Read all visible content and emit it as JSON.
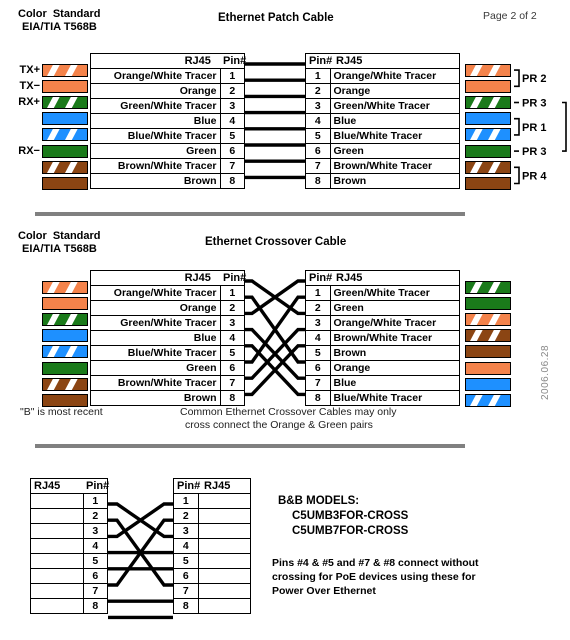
{
  "page": {
    "page_label": "Page 2 of 2",
    "date_stamp": "2006.06.28",
    "footnote": "\"B\" is most recent"
  },
  "standard": {
    "line1": "Color  Standard",
    "line2": "EIA/TIA T568B"
  },
  "colors": {
    "orange": "#F4834B",
    "green": "#1A7A1A",
    "blue": "#1E90FF",
    "brown": "#8B4513",
    "tracer": "#FFFFFF",
    "wire": "#000000",
    "divider": "#808080",
    "datestamp": "#8A8A8A"
  },
  "patch": {
    "title": "Ethernet Patch Cable",
    "left_header": {
      "rj45": "RJ45",
      "pin": "Pin#"
    },
    "right_header": {
      "pin": "Pin#",
      "rj45": "RJ45"
    },
    "signal_labels": [
      {
        "pin": 1,
        "text": "TX+"
      },
      {
        "pin": 2,
        "text": "TX−"
      },
      {
        "pin": 3,
        "text": "RX+"
      },
      {
        "pin": 6,
        "text": "RX−"
      }
    ],
    "left_rows": [
      {
        "pin": "1",
        "name": "Orange/White Tracer",
        "color": "orange",
        "tracer": true
      },
      {
        "pin": "2",
        "name": "Orange",
        "color": "orange",
        "tracer": false
      },
      {
        "pin": "3",
        "name": "Green/White Tracer",
        "color": "green",
        "tracer": true
      },
      {
        "pin": "4",
        "name": "Blue",
        "color": "blue",
        "tracer": false
      },
      {
        "pin": "5",
        "name": "Blue/White Tracer",
        "color": "blue",
        "tracer": true
      },
      {
        "pin": "6",
        "name": "Green",
        "color": "green",
        "tracer": false
      },
      {
        "pin": "7",
        "name": "Brown/White Tracer",
        "color": "brown",
        "tracer": true
      },
      {
        "pin": "8",
        "name": "Brown",
        "color": "brown",
        "tracer": false
      }
    ],
    "right_rows": [
      {
        "pin": "1",
        "name": "Orange/White Tracer",
        "color": "orange",
        "tracer": true
      },
      {
        "pin": "2",
        "name": "Orange",
        "color": "orange",
        "tracer": false
      },
      {
        "pin": "3",
        "name": "Green/White Tracer",
        "color": "green",
        "tracer": true
      },
      {
        "pin": "4",
        "name": "Blue",
        "color": "blue",
        "tracer": false
      },
      {
        "pin": "5",
        "name": "Blue/White Tracer",
        "color": "blue",
        "tracer": true
      },
      {
        "pin": "6",
        "name": "Green",
        "color": "green",
        "tracer": false
      },
      {
        "pin": "7",
        "name": "Brown/White Tracer",
        "color": "brown",
        "tracer": true
      },
      {
        "pin": "8",
        "name": "Brown",
        "color": "brown",
        "tracer": false
      }
    ],
    "pair_labels": [
      {
        "text": "PR 2",
        "pins": [
          1,
          2
        ]
      },
      {
        "text": "PR 3",
        "pins": [
          3
        ]
      },
      {
        "text": "PR 1",
        "pins": [
          4,
          5
        ]
      },
      {
        "text": "PR 3",
        "pins": [
          6
        ]
      },
      {
        "text": "PR 4",
        "pins": [
          7,
          8
        ]
      }
    ],
    "wiring": [
      {
        "from": 1,
        "to": 1
      },
      {
        "from": 2,
        "to": 2
      },
      {
        "from": 3,
        "to": 3
      },
      {
        "from": 4,
        "to": 4
      },
      {
        "from": 5,
        "to": 5
      },
      {
        "from": 6,
        "to": 6
      },
      {
        "from": 7,
        "to": 7
      },
      {
        "from": 8,
        "to": 8
      }
    ]
  },
  "crossover": {
    "title": "Ethernet Crossover Cable",
    "left_header": {
      "rj45": "RJ45",
      "pin": "Pin#"
    },
    "right_header": {
      "pin": "Pin#",
      "rj45": "RJ45"
    },
    "left_rows": [
      {
        "pin": "1",
        "name": "Orange/White Tracer",
        "color": "orange",
        "tracer": true
      },
      {
        "pin": "2",
        "name": "Orange",
        "color": "orange",
        "tracer": false
      },
      {
        "pin": "3",
        "name": "Green/White Tracer",
        "color": "green",
        "tracer": true
      },
      {
        "pin": "4",
        "name": "Blue",
        "color": "blue",
        "tracer": false
      },
      {
        "pin": "5",
        "name": "Blue/White Tracer",
        "color": "blue",
        "tracer": true
      },
      {
        "pin": "6",
        "name": "Green",
        "color": "green",
        "tracer": false
      },
      {
        "pin": "7",
        "name": "Brown/White Tracer",
        "color": "brown",
        "tracer": true
      },
      {
        "pin": "8",
        "name": "Brown",
        "color": "brown",
        "tracer": false
      }
    ],
    "right_rows": [
      {
        "pin": "1",
        "name": "Green/White Tracer",
        "color": "green",
        "tracer": true
      },
      {
        "pin": "2",
        "name": "Green",
        "color": "green",
        "tracer": false
      },
      {
        "pin": "3",
        "name": "Orange/White Tracer",
        "color": "orange",
        "tracer": true
      },
      {
        "pin": "4",
        "name": "Brown/White Tracer",
        "color": "brown",
        "tracer": true
      },
      {
        "pin": "5",
        "name": "Brown",
        "color": "brown",
        "tracer": false
      },
      {
        "pin": "6",
        "name": "Orange",
        "color": "orange",
        "tracer": false
      },
      {
        "pin": "7",
        "name": "Blue",
        "color": "blue",
        "tracer": false
      },
      {
        "pin": "8",
        "name": "Blue/White Tracer",
        "color": "blue",
        "tracer": true
      }
    ],
    "wiring": [
      {
        "from": 1,
        "to": 3
      },
      {
        "from": 2,
        "to": 6
      },
      {
        "from": 3,
        "to": 1
      },
      {
        "from": 4,
        "to": 7
      },
      {
        "from": 5,
        "to": 8
      },
      {
        "from": 6,
        "to": 2
      },
      {
        "from": 7,
        "to": 4
      },
      {
        "from": 8,
        "to": 5
      }
    ],
    "note_line1": "Common Ethernet Crossover Cables may only",
    "note_line2": "cross connect the Orange & Green pairs"
  },
  "poe": {
    "left_header": {
      "rj45": "RJ45",
      "pin": "Pin#"
    },
    "right_header": {
      "pin": "Pin#",
      "rj45": "RJ45"
    },
    "pins": [
      "1",
      "2",
      "3",
      "4",
      "5",
      "6",
      "7",
      "8"
    ],
    "wiring": [
      {
        "from": 1,
        "to": 3
      },
      {
        "from": 2,
        "to": 6
      },
      {
        "from": 3,
        "to": 1
      },
      {
        "from": 4,
        "to": 4
      },
      {
        "from": 5,
        "to": 5
      },
      {
        "from": 6,
        "to": 2
      },
      {
        "from": 7,
        "to": 7
      },
      {
        "from": 8,
        "to": 8
      }
    ],
    "models_title": "B&B MODELS:",
    "models": [
      "C5UMB3FOR-CROSS",
      "C5UMB7FOR-CROSS"
    ],
    "note_line1": "Pins #4 & #5 and #7 & #8 connect without",
    "note_line2": "crossing for PoE devices using these for",
    "note_line3": "Power Over Ethernet"
  }
}
